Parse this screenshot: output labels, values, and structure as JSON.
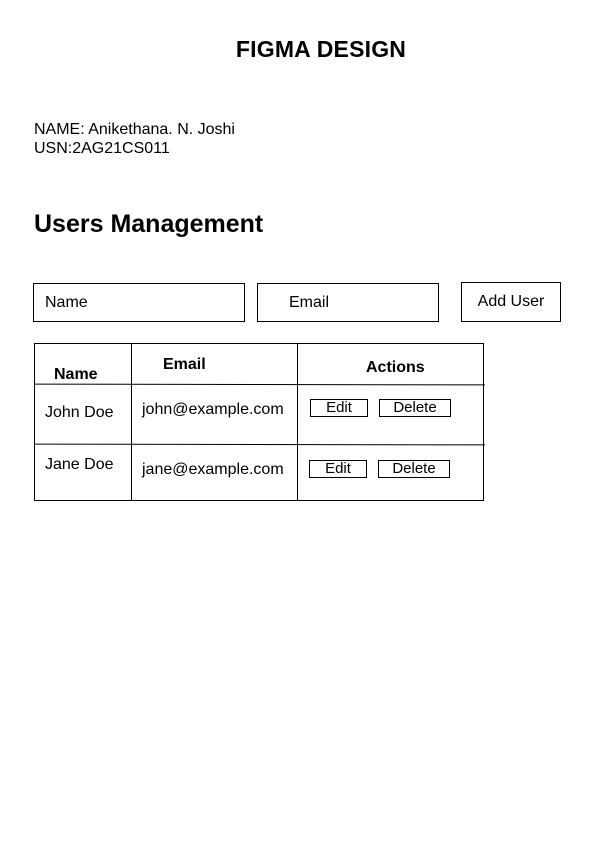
{
  "page": {
    "title": "FIGMA DESIGN",
    "student": {
      "name_line": "NAME: Anikethana. N. Joshi",
      "usn_line": "USN:2AG21CS011"
    },
    "section_title": "Users Management"
  },
  "form": {
    "name_placeholder": "Name",
    "email_placeholder": "Email",
    "add_button_label": "Add User"
  },
  "table": {
    "headers": {
      "name": "Name",
      "email": "Email",
      "actions": "Actions"
    },
    "rows": [
      {
        "name": "John Doe",
        "email": "john@example.com",
        "edit_label": "Edit",
        "delete_label": "Delete"
      },
      {
        "name": "Jane Doe",
        "email": "jane@example.com",
        "edit_label": "Edit",
        "delete_label": "Delete"
      }
    ]
  }
}
